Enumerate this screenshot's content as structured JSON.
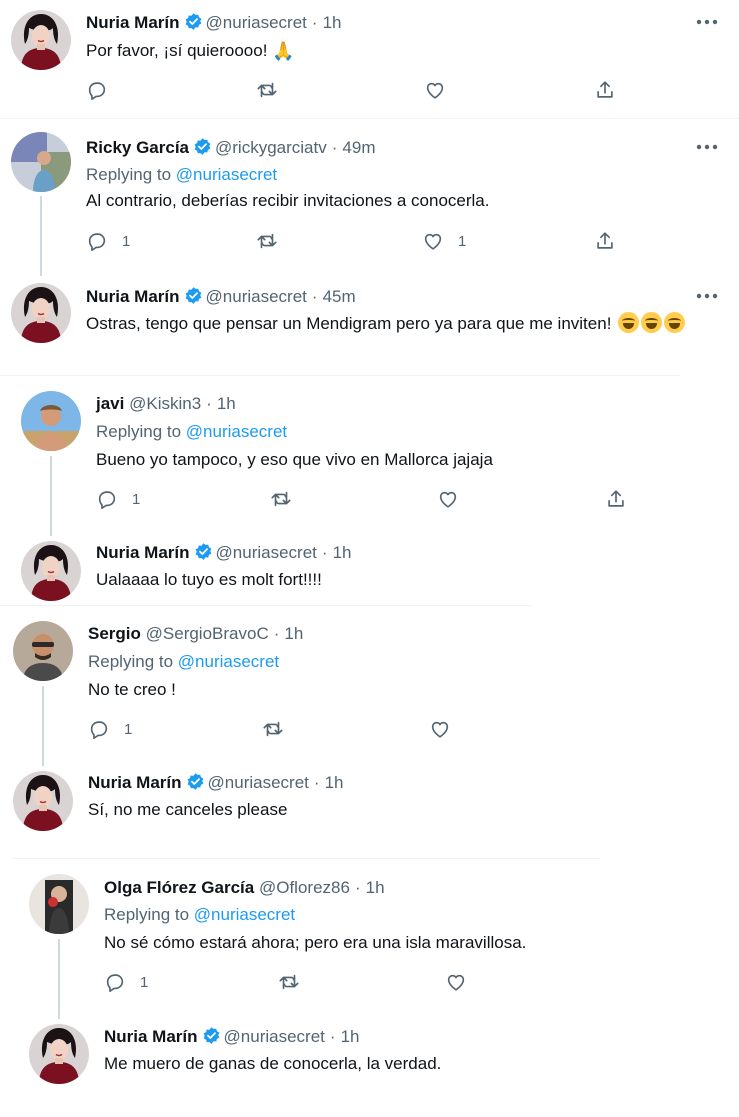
{
  "tweets": [
    {
      "name": "Nuria Marín",
      "handle": "@nuriasecret",
      "time": "1h",
      "verified": true,
      "text": "Por favor, ¡sí quieroooo!",
      "emoji_icon": "folded-hands-icon",
      "replies": "",
      "likes": ""
    },
    {
      "name": "Ricky García",
      "handle": "@rickygarciatv",
      "time": "49m",
      "verified": true,
      "replying_prefix": "Replying to",
      "replying_to": "@nuriasecret",
      "text": "Al contrario, deberías recibir invitaciones a conocerla.",
      "replies": "1",
      "likes": "1"
    },
    {
      "name": "Nuria Marín",
      "handle": "@nuriasecret",
      "time": "45m",
      "verified": true,
      "text": "Ostras, tengo que pensar un Mendigram pero ya para que me inviten!",
      "emoji_icon": "rolling-on-floor-laughing-icon"
    },
    {
      "name": "javi",
      "handle": "@Kiskin3",
      "time": "1h",
      "verified": false,
      "replying_prefix": "Replying to",
      "replying_to": "@nuriasecret",
      "text": "Bueno yo tampoco, y eso que vivo en Mallorca jajaja",
      "replies": "1"
    },
    {
      "name": "Nuria Marín",
      "handle": "@nuriasecret",
      "time": "1h",
      "verified": true,
      "text": "Ualaaaa lo tuyo es molt fort!!!!"
    },
    {
      "name": "Sergio",
      "handle": "@SergioBravoC",
      "time": "1h",
      "verified": false,
      "replying_prefix": "Replying to",
      "replying_to": "@nuriasecret",
      "text": "No te creo !",
      "replies": "1"
    },
    {
      "name": "Nuria Marín",
      "handle": "@nuriasecret",
      "time": "1h",
      "verified": true,
      "text": "Sí, no me canceles please"
    },
    {
      "name": "Olga Flórez García",
      "handle": "@Oflorez86",
      "time": "1h",
      "verified": false,
      "replying_prefix": "Replying to",
      "replying_to": "@nuriasecret",
      "text": "No sé cómo estará ahora; pero era una isla maravillosa.",
      "replies": "1"
    },
    {
      "name": "Nuria Marín",
      "handle": "@nuriasecret",
      "time": "1h",
      "verified": true,
      "text": "Me muero de ganas de conocerla, la verdad."
    }
  ],
  "colors": {
    "accent": "#1d9bf0",
    "text": "#0f1419",
    "secondary": "#536471",
    "thread_line": "#cfd9de",
    "separator": "#eff3f4"
  },
  "icons": {
    "reply": "reply-icon",
    "retweet": "retweet-icon",
    "like": "heart-icon",
    "share": "share-icon",
    "more": "more-options-icon",
    "verified": "verified-badge-icon"
  }
}
